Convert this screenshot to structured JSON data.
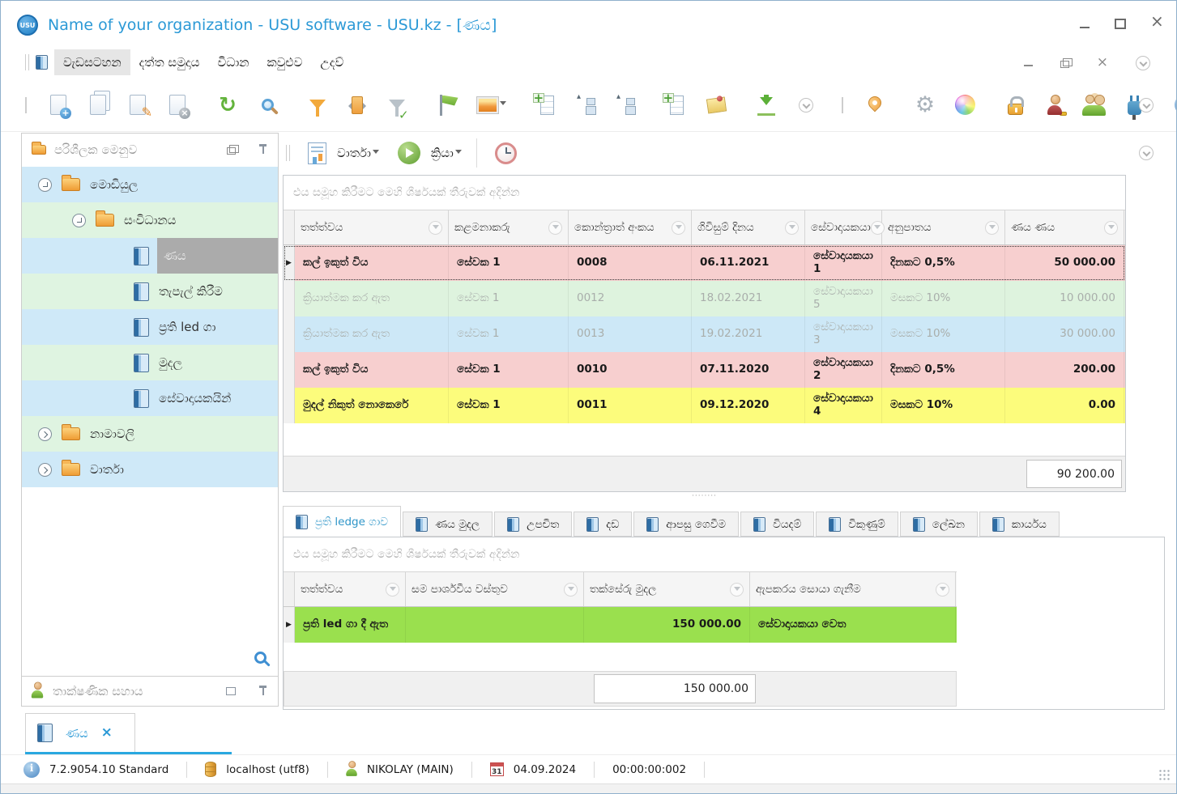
{
  "window": {
    "title": "Name of your organization - USU software - USU.kz - [ණය]",
    "logo_text": "USU"
  },
  "menu": {
    "items": [
      "වැඩසටහන",
      "දත්ත සමුදාය",
      "විධාන",
      "කවුළුව",
      "උදව්"
    ],
    "selected": "වැඩසටහන"
  },
  "toolbar": {
    "icons": [
      "add-record",
      "copy-record",
      "edit-record",
      "delete-record",
      "refresh",
      "search",
      "filter",
      "filter-panel",
      "filter-apply",
      "flag",
      "image",
      "table-expand",
      "tree-collapse",
      "tree-structure",
      "add-column",
      "notes",
      "export",
      "more",
      "map-location",
      "settings",
      "appearance",
      "lock",
      "access-rights",
      "users",
      "plugins",
      "info"
    ]
  },
  "report_bar": {
    "reports_label": "වාර්තා",
    "actions_label": "ක්‍රියා"
  },
  "left_panel": {
    "title": "පරිශීලක මෙනුව",
    "tree": [
      {
        "label": "මොඩියුල"
      },
      {
        "label": "සංවිධානය"
      },
      {
        "label": "ණය"
      },
      {
        "label": "තැපැල් කිරීම"
      },
      {
        "label": "ප්‍රති led ගා"
      },
      {
        "label": "මුදල"
      },
      {
        "label": "සේවාදායකයින්"
      },
      {
        "label": "නාමාවලි"
      },
      {
        "label": "වාර්තා"
      }
    ]
  },
  "support_panel": {
    "title": "තාක්ෂණික සහාය"
  },
  "doc_tab": {
    "label": "ණය"
  },
  "main_grid": {
    "group_hint": "එය සමූහ කිරීමට මෙහි ශීර්ෂයක් තීරුවක් අදින්න",
    "columns": [
      "තත්ත්වය",
      "කළමනාකරු",
      "කොන්ත්‍රාත් අංකය",
      "ගිවිසුම් දිනය",
      "සේවාදායකයා",
      "අනුපාතය",
      "ණය ණය"
    ],
    "rows": [
      {
        "status": "කල් ඉකුත් විය",
        "manager": "සේවක 1",
        "contract": "0008",
        "date": "06.11.2021",
        "client": "සේවාදායකයා 1",
        "rate": "දිනකට 0,5%",
        "amount": "50 000.00",
        "color": "#f7cfcf",
        "selected": true
      },
      {
        "status": "ක්‍රියාත්මක කර ඇත",
        "manager": "සේවක 1",
        "contract": "0012",
        "date": "18.02.2021",
        "client": "සේවාදායකයා 5",
        "rate": "මසකට 10%",
        "amount": "10 000.00",
        "color": "#def3de",
        "muted": true
      },
      {
        "status": "ක්‍රියාත්මක කර ඇත",
        "manager": "සේවක 1",
        "contract": "0013",
        "date": "19.02.2021",
        "client": "සේවාදායකයා 3",
        "rate": "මසකට 10%",
        "amount": "30 000.00",
        "color": "#cde8f7",
        "muted": true
      },
      {
        "status": "කල් ඉකුත් විය",
        "manager": "සේවක 1",
        "contract": "0010",
        "date": "07.11.2020",
        "client": "සේවාදායකයා 2",
        "rate": "දිනකට 0,5%",
        "amount": "200.00",
        "color": "#f7cfcf"
      },
      {
        "status": "මුදල් නිකුත් නොකෙරේ",
        "manager": "සේවක 1",
        "contract": "0011",
        "date": "09.12.2020",
        "client": "සේවාදායකයා 4",
        "rate": "මසකට 10%",
        "amount": "0.00",
        "color": "#fcfc7c"
      }
    ],
    "total": "90 200.00"
  },
  "sub_tabs": {
    "items": [
      "ප්‍රති ledge ගාව",
      "ණය මුදල",
      "උපචිත",
      "දඩ",
      "ආපසු ගෙවීම",
      "වියදම්",
      "විකුණුම්",
      "ලේඛන",
      "කාර්යය"
    ],
    "active": "ප්‍රති ledge ගාව"
  },
  "sub_grid": {
    "group_hint": "එය සමූහ කිරීමට මෙහි ශීර්ෂයක් තීරුවක් අදින්න",
    "columns": [
      "තත්ත්වය",
      "සම පාර්ශවීය වස්තුව",
      "තක්සේරු මුදල",
      "ඇපකරය සොයා ගැනීම"
    ],
    "rows": [
      {
        "status": "ප්‍රති led ගා දී ඇත",
        "object": "",
        "amount": "150 000.00",
        "search": "සේවාදායකයා වෙත",
        "color": "#9ae04e"
      }
    ],
    "total": "150 000.00"
  },
  "statusbar": {
    "version": "7.2.9054.10 Standard",
    "database": "localhost (utf8)",
    "user": "NIKOLAY (MAIN)",
    "calendar_day": "31",
    "date": "04.09.2024",
    "time": "00:00:00:002"
  },
  "colors": {
    "accent_blue": "#2b99d6",
    "row_pink": "#f7cfcf",
    "row_green": "#def3de",
    "row_blue": "#cde8f7",
    "row_yellow": "#fcfc7c",
    "row_bright_green": "#9ae04e",
    "tree_row_blue": "#cfe9f8",
    "tree_row_green": "#dff4e1",
    "selection_gray": "#ababab",
    "tab_underline": "#29a8e0"
  }
}
